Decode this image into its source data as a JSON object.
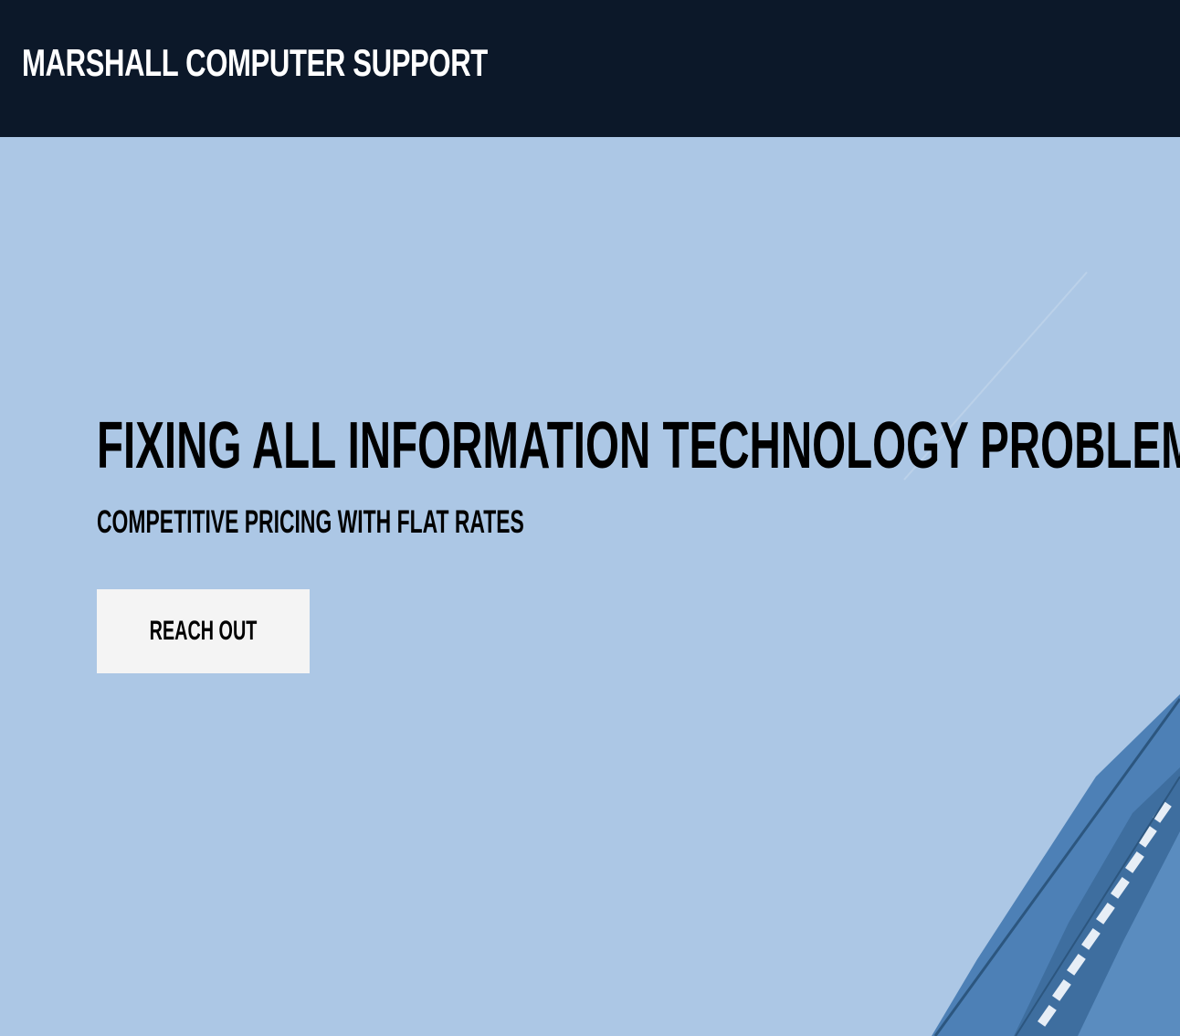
{
  "header": {
    "brand": "MARSHALL COMPUTER SUPPORT"
  },
  "hero": {
    "headline": "FIXING ALL INFORMATION TECHNOLOGY PROBLEMS",
    "subheadline": "COMPETITIVE PRICING WITH FLAT RATES",
    "cta_label": "REACH OUT",
    "image_icon": "server-hardware-illustration"
  },
  "colors": {
    "header_bg": "#0c1829",
    "hero_bg": "#acc7e5",
    "button_bg": "#f4f4f4",
    "hardware_blue": "#4a7fb5"
  }
}
